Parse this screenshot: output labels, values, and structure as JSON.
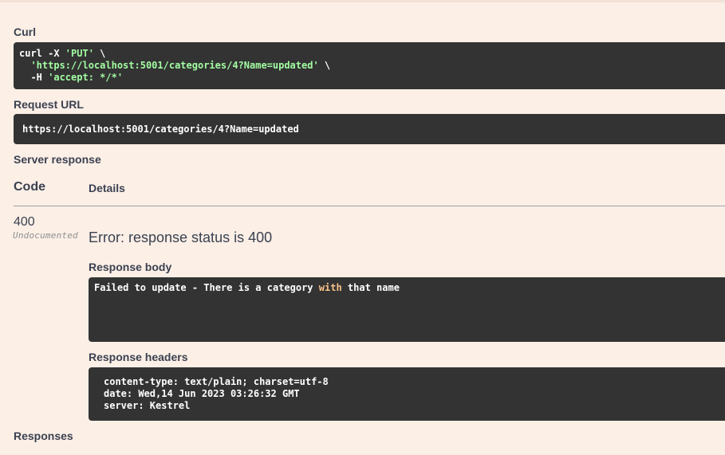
{
  "curl": {
    "label": "Curl",
    "line1_prefix": "curl -X ",
    "line1_method": "'PUT'",
    "line1_suffix": " \\",
    "line2_indent": "  ",
    "line2_url": "'https://localhost:5001/categories/4?Name=updated'",
    "line2_suffix": " \\",
    "line3_indent": "  -H ",
    "line3_header": "'accept: */*'"
  },
  "request_url": {
    "label": "Request URL",
    "value": "https://localhost:5001/categories/4?Name=updated"
  },
  "server_response": {
    "label": "Server response",
    "col_code": "Code",
    "col_details": "Details",
    "code": "400",
    "code_note": "Undocumented",
    "error": "Error: response status is 400",
    "body_label": "Response body",
    "body_before": "Failed to update - There is a category ",
    "body_keyword": "with",
    "body_after": " that name",
    "headers_label": "Response headers",
    "headers": [
      "content-type: text/plain; charset=utf-8",
      "date: Wed,14 Jun 2023 03:26:32 GMT",
      "server: Kestrel"
    ]
  },
  "responses": {
    "label": "Responses"
  },
  "colors": {
    "background": "#fbefe6",
    "code_bg": "#333333",
    "string": "#a2fca2",
    "keyword": "#fcc28c"
  }
}
